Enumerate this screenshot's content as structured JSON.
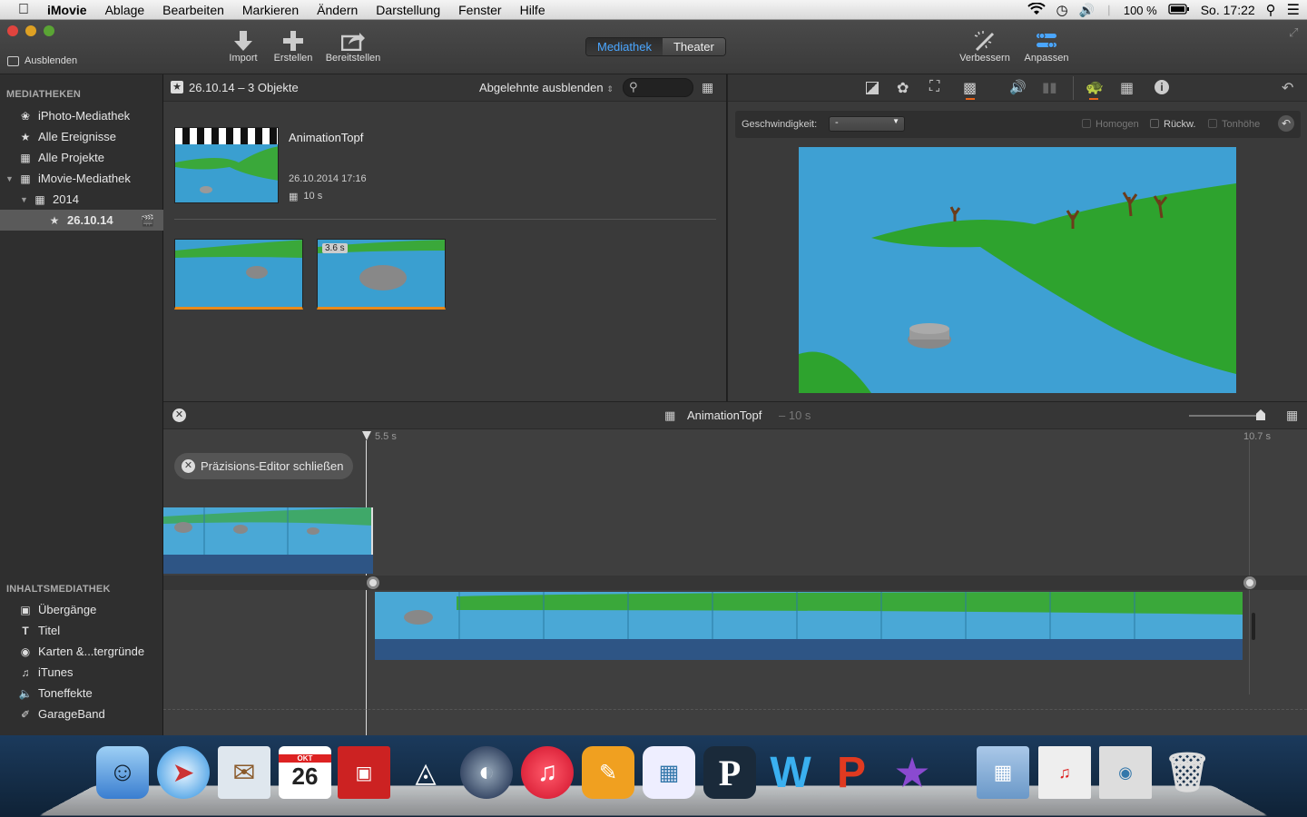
{
  "menubar": {
    "apple": "",
    "app": "iMovie",
    "items": [
      "Ablage",
      "Bearbeiten",
      "Markieren",
      "Ändern",
      "Darstellung",
      "Fenster",
      "Hilfe"
    ],
    "battery": "100 %",
    "clock": "So. 17:22"
  },
  "toolbar": {
    "hide_label": "Ausblenden",
    "import_label": "Import",
    "create_label": "Erstellen",
    "share_label": "Bereitstellen",
    "library_tab": "Mediathek",
    "theater_tab": "Theater",
    "enhance_label": "Verbessern",
    "adjust_label": "Anpassen"
  },
  "sidebar": {
    "libraries_header": "MEDIATHEKEN",
    "items": [
      {
        "label": "iPhoto-Mediathek",
        "icon": "iphoto-icon"
      },
      {
        "label": "Alle Ereignisse",
        "icon": "star-icon"
      },
      {
        "label": "Alle Projekte",
        "icon": "projects-icon"
      },
      {
        "label": "iMovie-Mediathek",
        "icon": "grid-icon"
      },
      {
        "label": "2014",
        "icon": "calendar-icon"
      },
      {
        "label": "26.10.14",
        "icon": "star-icon"
      }
    ],
    "content_header": "INHALTSMEDIATHEK",
    "content_items": [
      {
        "label": "Übergänge",
        "icon": "transitions-icon"
      },
      {
        "label": "Titel",
        "icon": "title-icon"
      },
      {
        "label": "Karten &...tergründe",
        "icon": "globe-icon"
      },
      {
        "label": "iTunes",
        "icon": "note-icon"
      },
      {
        "label": "Toneffekte",
        "icon": "speaker-icon"
      },
      {
        "label": "GarageBand",
        "icon": "guitar-icon"
      }
    ]
  },
  "browser": {
    "event_title": "26.10.14 – 3 Objekte",
    "filter": "Abgelehnte ausblenden",
    "search_placeholder": "",
    "project_name": "AnimationTopf",
    "project_date": "26.10.2014 17:16",
    "project_duration": "10 s",
    "clip2_badge": "3.6 s"
  },
  "viewer": {
    "speed_label": "Geschwindigkeit:",
    "speed_value": "-",
    "smooth_label": "Homogen",
    "reverse_label": "Rückw.",
    "pitch_label": "Tonhöhe"
  },
  "timeline": {
    "project_name": "AnimationTopf",
    "project_duration": "– 10 s",
    "playhead_time": "5.5 s",
    "end_time": "10.7 s",
    "close_precision": "Präzisions-Editor schließen"
  },
  "colors": {
    "accent": "#4aa6ff",
    "water": "#3a9fd0",
    "grass": "#3aa83a",
    "clip_audio": "#2e5585"
  },
  "dock": {
    "calendar_month": "OKT",
    "calendar_day": "26",
    "icons": [
      "finder-icon",
      "safari-icon",
      "mail-icon",
      "calendar-icon",
      "photo-booth-icon",
      "unity-icon",
      "cinema4d-icon",
      "itunes-icon",
      "pages-icon",
      "preview-icon",
      "pixelmator-icon",
      "word-icon",
      "powerpoint-icon",
      "imovie-icon",
      "folder-icon",
      "screenshot-icon",
      "screenshot2-icon",
      "trash-icon"
    ]
  }
}
